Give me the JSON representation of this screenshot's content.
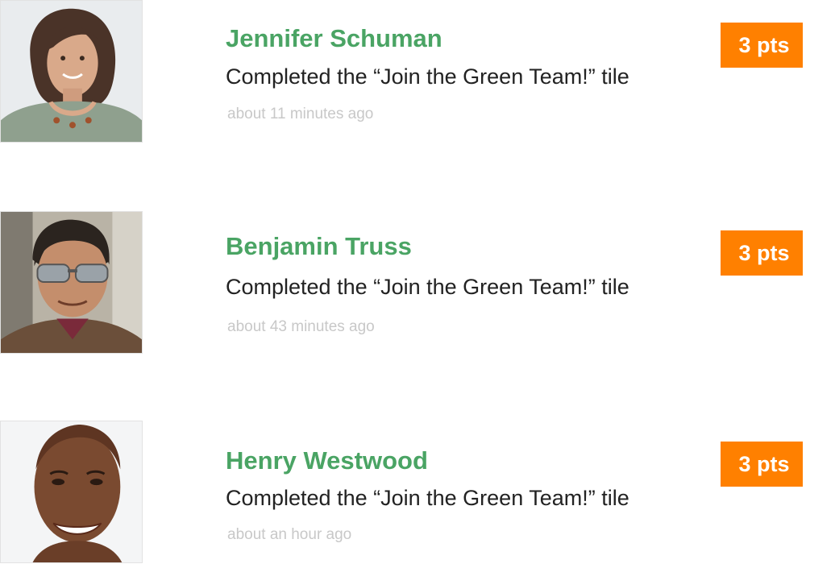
{
  "colors": {
    "name_green": "#4aa464",
    "badge_orange": "#ff8000",
    "activity_text": "#222222",
    "timestamp_text": "#c8c8c8"
  },
  "feed": [
    {
      "name": "Jennifer Schuman",
      "activity": "Completed the “Join the Green Team!” tile",
      "time": "about 11 minutes ago",
      "points": "3 pts",
      "avatar_icon": "woman-portrait-avatar"
    },
    {
      "name": "Benjamin Truss",
      "activity": "Completed the “Join the Green Team!” tile",
      "time": "about 43 minutes ago",
      "points": "3 pts",
      "avatar_icon": "man-sunglasses-portrait-avatar"
    },
    {
      "name": "Henry Westwood",
      "activity": "Completed the “Join the Green Team!” tile",
      "time": "about an hour ago",
      "points": "3 pts",
      "avatar_icon": "smiling-man-portrait-avatar"
    }
  ]
}
